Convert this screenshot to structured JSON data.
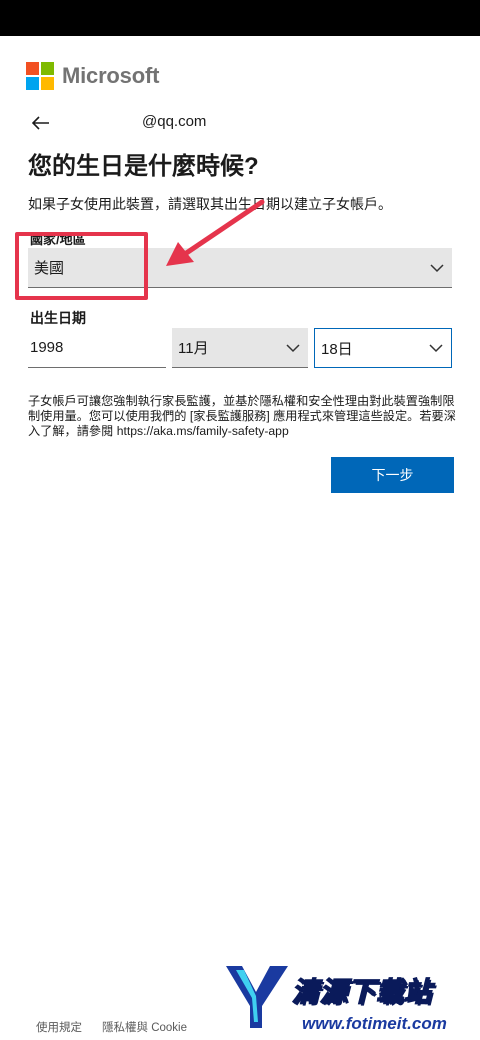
{
  "brand": {
    "name": "Microsoft",
    "colors": [
      "#f25022",
      "#7fba00",
      "#00a4ef",
      "#ffb900"
    ]
  },
  "header": {
    "email": "@qq.com"
  },
  "page": {
    "title": "您的生日是什麼時候?",
    "description": "如果子女使用此裝置，請選取其出生日期以建立子女帳戶。"
  },
  "country": {
    "label": "國家/地區",
    "value": "美國"
  },
  "birthdate": {
    "label": "出生日期",
    "year": "1998",
    "month": "11月",
    "day": "18日"
  },
  "info_text": "子女帳戶可讓您強制執行家長監護，並基於隱私權和安全性理由對此裝置強制限制使用量。您可以使用我們的 [家長監護服務] 應用程式來管理這些設定。若要深入了解，請參閱 https://aka.ms/family-safety-app",
  "next_button": "下一步",
  "footer": {
    "terms": "使用規定",
    "privacy": "隱私權與 Cookie"
  },
  "watermark": {
    "title": "清源下载站",
    "url": "www.fotimeit.com"
  },
  "colors": {
    "accent": "#0067b8",
    "annotation": "#e5344c"
  }
}
